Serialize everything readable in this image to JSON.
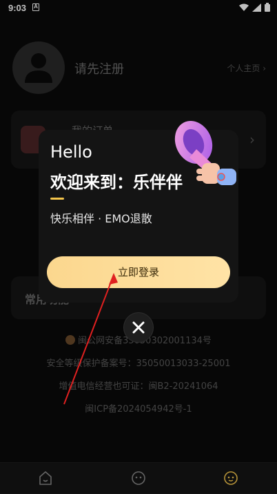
{
  "status_bar": {
    "time": "9:03",
    "notif_glyph": "A"
  },
  "profile": {
    "register_text": "请先注册",
    "profile_link": "个人主页"
  },
  "order_card": {
    "title": "我的订单"
  },
  "common_card": {
    "title": "常用功能"
  },
  "footer": {
    "lines": [
      "闽公网安备35050302001134号",
      "安全等级保护备案号：35050013033-25001",
      "增值电信经营也可证：闽B2-20241064",
      "闽ICP备2024054942号-1"
    ]
  },
  "modal": {
    "hello": "Hello",
    "welcome": "欢迎来到：乐伴伴",
    "slogan": "快乐相伴 · EMO退散",
    "login_label": "立即登录"
  },
  "tabbar": {
    "icons": [
      "home-icon",
      "chat-icon",
      "profile-icon"
    ],
    "active_color": "#f5c64c"
  },
  "colors": {
    "accent": "#f5c64c",
    "button_gradient_start": "#fbd78e",
    "button_gradient_end": "#ffe3a6",
    "annotation_arrow": "#e02020"
  }
}
